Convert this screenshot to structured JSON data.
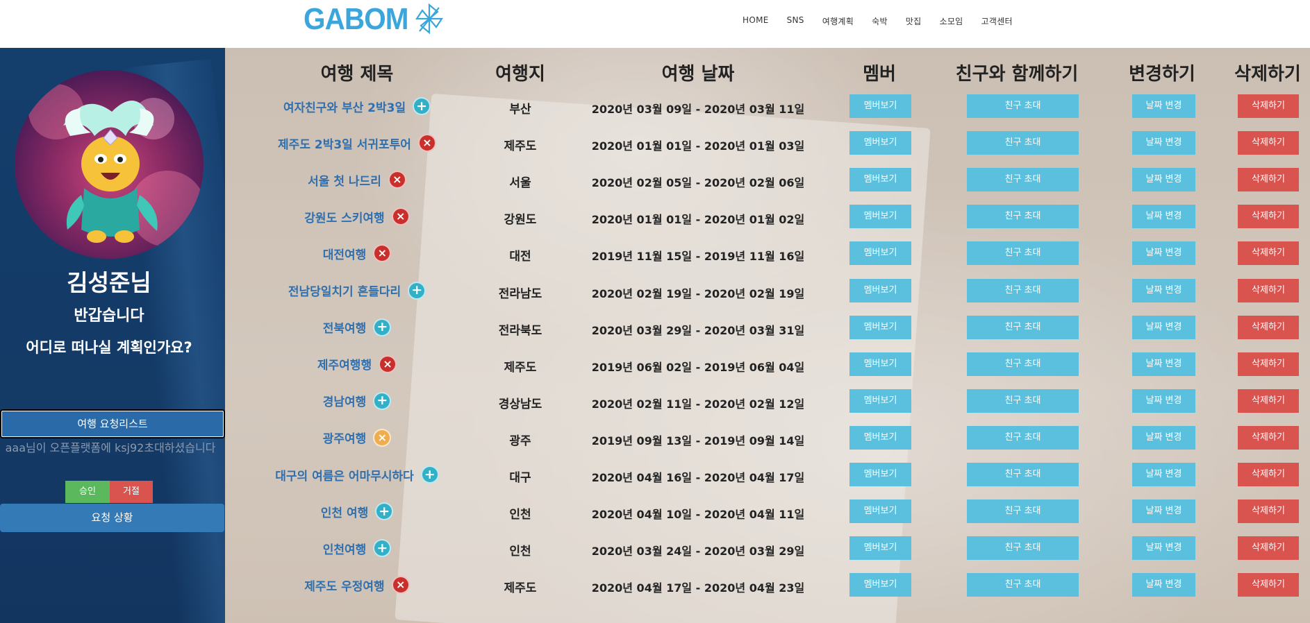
{
  "header": {
    "logo_text": "GABOM",
    "nav": [
      "HOME",
      "SNS",
      "여행계획",
      "숙박",
      "맛집",
      "소모임",
      "고객센터"
    ]
  },
  "sidebar": {
    "user_name": "김성준님",
    "greeting": "반갑습니다",
    "question": "어디로 떠나실 계획인가요?",
    "request_list_label": "여행 요청리스트",
    "invite_message": "aaa님이 오픈플랫폼에 ksj92초대하셨습니다",
    "accept_label": "승인",
    "reject_label": "거절",
    "status_label": "요청 상황"
  },
  "table": {
    "headers": {
      "title": "여행 제목",
      "destination": "여행지",
      "date": "여행 날짜",
      "member": "멤버",
      "invite": "친구와 함께하기",
      "change": "변경하기",
      "delete": "삭제하기"
    },
    "button_labels": {
      "member": "멤버보기",
      "invite": "친구 초대",
      "change": "날짜 변경",
      "delete": "삭제하기"
    },
    "rows": [
      {
        "title": "여자친구와 부산 2박3일",
        "icon": "plus",
        "destination": "부산",
        "date": "2020년 03월 09일 - 2020년 03월 11일"
      },
      {
        "title": "제주도 2박3일 서귀포투어",
        "icon": "x",
        "destination": "제주도",
        "date": "2020년 01월 01일 - 2020년 01월 03일"
      },
      {
        "title": "서울 첫 나드리",
        "icon": "x",
        "destination": "서울",
        "date": "2020년 02월 05일 - 2020년 02월 06일"
      },
      {
        "title": "강원도 스키여행",
        "icon": "x",
        "destination": "강원도",
        "date": "2020년 01월 01일 - 2020년 01월 02일"
      },
      {
        "title": "대전여행",
        "icon": "x",
        "destination": "대전",
        "date": "2019년 11월 15일 - 2019년 11월 16일"
      },
      {
        "title": "전남당일치기 흔들다리",
        "icon": "plus",
        "destination": "전라남도",
        "date": "2020년 02월 19일 - 2020년 02월 19일"
      },
      {
        "title": "전북여행",
        "icon": "plus",
        "destination": "전라북도",
        "date": "2020년 03월 29일 - 2020년 03월 31일"
      },
      {
        "title": "제주여행행",
        "icon": "x",
        "destination": "제주도",
        "date": "2019년 06월 02일 - 2019년 06월 04일"
      },
      {
        "title": "경남여행",
        "icon": "plus",
        "destination": "경상남도",
        "date": "2020년 02월 11일 - 2020년 02월 12일"
      },
      {
        "title": "광주여행",
        "icon": "orange",
        "destination": "광주",
        "date": "2019년 09월 13일 - 2019년 09월 14일"
      },
      {
        "title": "대구의 여름은 어마무시하다",
        "icon": "plus",
        "destination": "대구",
        "date": "2020년 04월 16일 - 2020년 04월 17일"
      },
      {
        "title": "인천 여행",
        "icon": "plus",
        "destination": "인천",
        "date": "2020년 04월 10일 - 2020년 04월 11일"
      },
      {
        "title": "인천여행",
        "icon": "plus",
        "destination": "인천",
        "date": "2020년 03월 24일 - 2020년 03월 29일"
      },
      {
        "title": "제주도 우정여행",
        "icon": "x",
        "destination": "제주도",
        "date": "2020년 04월 17일 - 2020년 04월 23일"
      }
    ]
  },
  "colors": {
    "brand": "#3aa6dc",
    "sidebar_bg": "#143e6c",
    "info_button": "#5bc0de",
    "danger_button": "#d9534f",
    "accept_button": "#5cb85c",
    "link": "#2f6fae"
  }
}
